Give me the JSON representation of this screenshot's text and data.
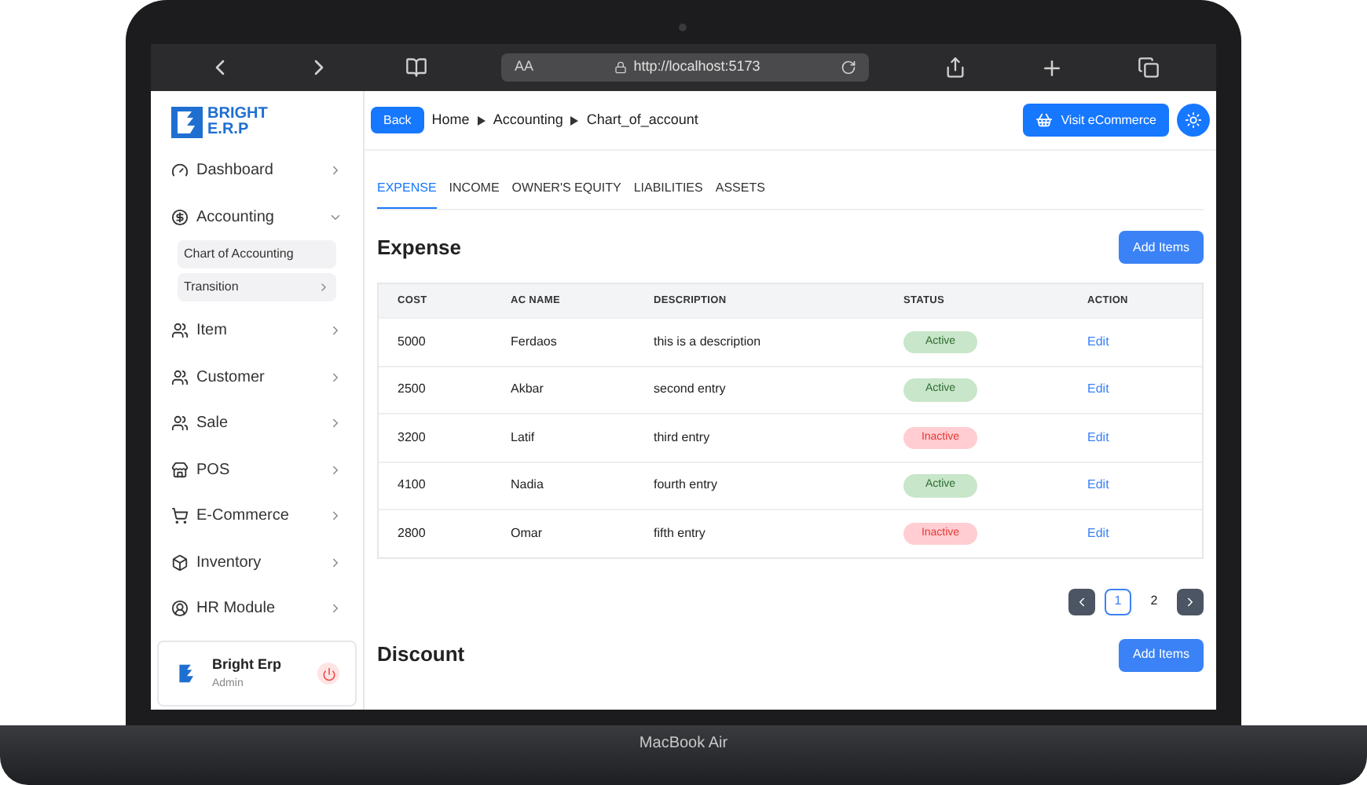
{
  "device": {
    "label": "MacBook Air"
  },
  "browser": {
    "text_size": "AA",
    "url": "http://localhost:5173"
  },
  "sidebar": {
    "logo": {
      "line1": "BRIGHT",
      "line2": "E.R.P"
    },
    "items": [
      {
        "label": "Dashboard",
        "expanded": false
      },
      {
        "label": "Accounting",
        "expanded": true,
        "children": [
          {
            "label": "Chart of Accounting",
            "expandable": false
          },
          {
            "label": "Transition",
            "expandable": true
          }
        ]
      },
      {
        "label": "Item",
        "expanded": false
      },
      {
        "label": "Customer",
        "expanded": false
      },
      {
        "label": "Sale",
        "expanded": false
      },
      {
        "label": "POS",
        "expanded": false
      },
      {
        "label": "E-Commerce",
        "expanded": false
      },
      {
        "label": "Inventory",
        "expanded": false
      },
      {
        "label": "HR Module",
        "expanded": false
      }
    ],
    "user": {
      "name": "Bright Erp",
      "role": "Admin"
    }
  },
  "header": {
    "back": "Back",
    "breadcrumb": [
      "Home",
      "Accounting",
      "Chart_of_account"
    ],
    "visit": "Visit eCommerce"
  },
  "tabs": [
    {
      "label": "EXPENSE",
      "selected": true
    },
    {
      "label": "INCOME",
      "selected": false
    },
    {
      "label": "OWNER'S EQUITY",
      "selected": false
    },
    {
      "label": "LIABILITIES",
      "selected": false
    },
    {
      "label": "ASSETS",
      "selected": false
    }
  ],
  "expense": {
    "title": "Expense",
    "add": "Add Items",
    "table": {
      "columns": [
        "COST",
        "AC NAME",
        "DESCRIPTION",
        "STATUS",
        "ACTION"
      ],
      "rows": [
        {
          "cost": "5000",
          "name": "Ferdaos",
          "description": "this is a description",
          "status": "Active",
          "active": true,
          "action": "Edit"
        },
        {
          "cost": "2500",
          "name": "Akbar",
          "description": "second entry",
          "status": "Active",
          "active": true,
          "action": "Edit"
        },
        {
          "cost": "3200",
          "name": "Latif",
          "description": "third entry",
          "status": "Inactive",
          "active": false,
          "action": "Edit"
        },
        {
          "cost": "4100",
          "name": "Nadia",
          "description": "fourth entry",
          "status": "Active",
          "active": true,
          "action": "Edit"
        },
        {
          "cost": "2800",
          "name": "Omar",
          "description": "fifth entry",
          "status": "Inactive",
          "active": false,
          "action": "Edit"
        }
      ]
    },
    "pages": [
      {
        "label": "1",
        "selected": true
      },
      {
        "label": "2",
        "selected": false
      }
    ]
  },
  "discount": {
    "title": "Discount",
    "add": "Add Items"
  }
}
